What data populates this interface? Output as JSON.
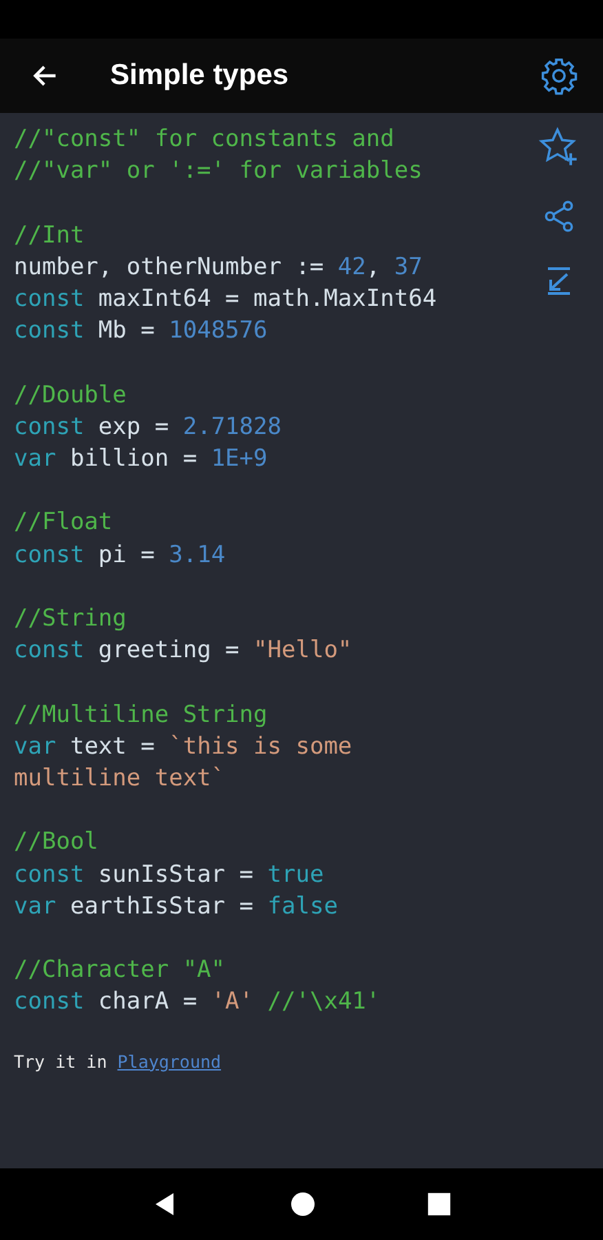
{
  "toolbar": {
    "title": "Simple types"
  },
  "code_blocks": [
    {
      "lines": [
        [
          {
            "kind": "comment",
            "text": "//\"const\" for constants and"
          }
        ],
        [
          {
            "kind": "comment",
            "text": "//\"var\" or ':=' for variables"
          }
        ]
      ]
    },
    {
      "lines": [
        [
          {
            "kind": "comment",
            "text": "//Int"
          }
        ],
        [
          {
            "kind": "plain",
            "text": "number, otherNumber := "
          },
          {
            "kind": "number",
            "text": "42"
          },
          {
            "kind": "plain",
            "text": ", "
          },
          {
            "kind": "number",
            "text": "37"
          }
        ],
        [
          {
            "kind": "keyword",
            "text": "const"
          },
          {
            "kind": "plain",
            "text": " maxInt64 = math.MaxInt64"
          }
        ],
        [
          {
            "kind": "keyword",
            "text": "const"
          },
          {
            "kind": "plain",
            "text": " Mb = "
          },
          {
            "kind": "number",
            "text": "1048576"
          }
        ]
      ]
    },
    {
      "lines": [
        [
          {
            "kind": "comment",
            "text": "//Double"
          }
        ],
        [
          {
            "kind": "keyword",
            "text": "const"
          },
          {
            "kind": "plain",
            "text": " exp = "
          },
          {
            "kind": "number",
            "text": "2.71828"
          }
        ],
        [
          {
            "kind": "keyword",
            "text": "var"
          },
          {
            "kind": "plain",
            "text": " billion = "
          },
          {
            "kind": "number",
            "text": "1E+9"
          }
        ]
      ]
    },
    {
      "lines": [
        [
          {
            "kind": "comment",
            "text": "//Float"
          }
        ],
        [
          {
            "kind": "keyword",
            "text": "const"
          },
          {
            "kind": "plain",
            "text": " pi = "
          },
          {
            "kind": "number",
            "text": "3.14"
          }
        ]
      ]
    },
    {
      "lines": [
        [
          {
            "kind": "comment",
            "text": "//String"
          }
        ],
        [
          {
            "kind": "keyword",
            "text": "const"
          },
          {
            "kind": "plain",
            "text": " greeting = "
          },
          {
            "kind": "string",
            "text": "\"Hello\""
          }
        ]
      ]
    },
    {
      "lines": [
        [
          {
            "kind": "comment",
            "text": "//Multiline String"
          }
        ],
        [
          {
            "kind": "keyword",
            "text": "var"
          },
          {
            "kind": "plain",
            "text": " text = "
          },
          {
            "kind": "string",
            "text": "`this is some"
          }
        ],
        [
          {
            "kind": "string",
            "text": "multiline text`"
          }
        ]
      ]
    },
    {
      "lines": [
        [
          {
            "kind": "comment",
            "text": "//Bool"
          }
        ],
        [
          {
            "kind": "keyword",
            "text": "const"
          },
          {
            "kind": "plain",
            "text": " sunIsStar = "
          },
          {
            "kind": "keyword",
            "text": "true"
          }
        ],
        [
          {
            "kind": "keyword",
            "text": "var"
          },
          {
            "kind": "plain",
            "text": " earthIsStar = "
          },
          {
            "kind": "keyword",
            "text": "false"
          }
        ]
      ]
    },
    {
      "lines": [
        [
          {
            "kind": "comment",
            "text": "//Character \"A\""
          }
        ],
        [
          {
            "kind": "keyword",
            "text": "const"
          },
          {
            "kind": "plain",
            "text": " charA = "
          },
          {
            "kind": "string",
            "text": "'A'"
          },
          {
            "kind": "comment",
            "text": " //'\\x41'"
          }
        ]
      ]
    }
  ],
  "footer": {
    "text": "Try it in ",
    "link": "Playground"
  }
}
